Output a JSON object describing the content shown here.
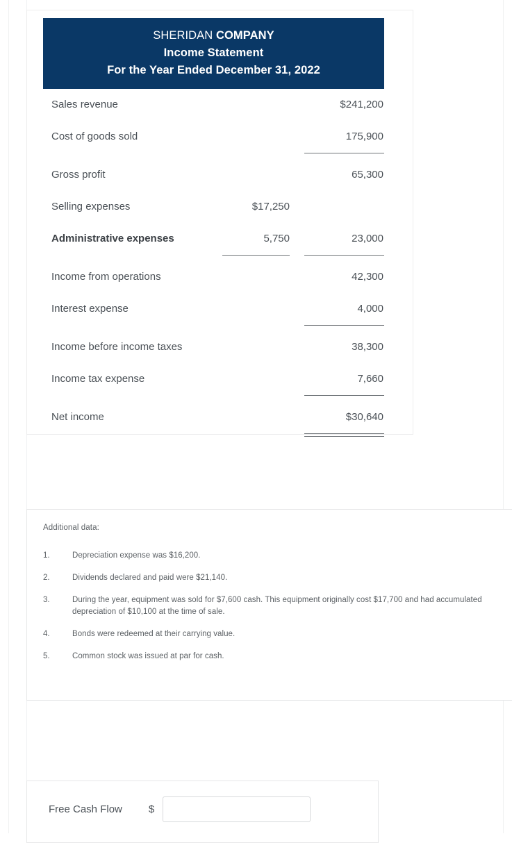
{
  "statement": {
    "header": {
      "company_light": "SHERIDAN ",
      "company_bold": "COMPANY",
      "title": "Income Statement",
      "period": "For the Year Ended December 31, 2022"
    },
    "rows": [
      {
        "label": "Sales revenue",
        "amount1": "",
        "amount2": "$241,200"
      },
      {
        "label": "Cost of goods sold",
        "amount1": "",
        "amount2": "175,900"
      },
      {
        "label": "Gross profit",
        "amount1": "",
        "amount2": "65,300"
      },
      {
        "label": "Selling expenses",
        "amount1": "$17,250",
        "amount2": ""
      },
      {
        "label": "Administrative expenses",
        "amount1": "5,750",
        "amount2": "23,000"
      },
      {
        "label": "Income from operations",
        "amount1": "",
        "amount2": "42,300"
      },
      {
        "label": "Interest expense",
        "amount1": "",
        "amount2": "4,000"
      },
      {
        "label": "Income before income taxes",
        "amount1": "",
        "amount2": "38,300"
      },
      {
        "label": "Income tax expense",
        "amount1": "",
        "amount2": "7,660"
      },
      {
        "label": "Net income",
        "amount1": "",
        "amount2": "$30,640"
      }
    ],
    "header_bg_color": "#0a3866"
  },
  "additional": {
    "title": "Additional data:",
    "items": [
      {
        "num": "1.",
        "text": "Depreciation expense was $16,200."
      },
      {
        "num": "2.",
        "text": "Dividends declared and paid were $21,140."
      },
      {
        "num": "3.",
        "text": "During the year, equipment was sold for $7,600 cash. This equipment originally cost $17,700 and had accumulated depreciation of $10,100 at the time of sale."
      },
      {
        "num": "4.",
        "text": "Bonds were redeemed at their carrying value."
      },
      {
        "num": "5.",
        "text": "Common stock was issued at par for cash."
      }
    ]
  },
  "free_cash_flow": {
    "label": "Free Cash Flow",
    "currency_symbol": "$",
    "value": "",
    "placeholder": ""
  }
}
